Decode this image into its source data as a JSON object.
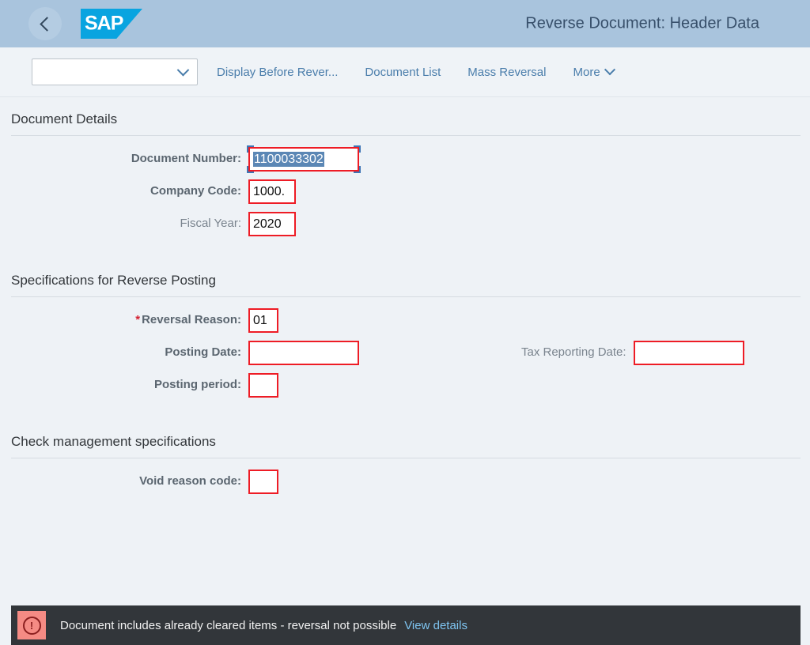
{
  "shell": {
    "back_icon": "chevron-left-icon",
    "logo_text": "SAP",
    "title": "Reverse Document: Header Data"
  },
  "toolbar": {
    "variant_value": "",
    "variant_icon": "chevron-down-icon",
    "buttons": [
      {
        "label": "Display Before Rever...",
        "icon": ""
      },
      {
        "label": "Document List",
        "icon": ""
      },
      {
        "label": "Mass Reversal",
        "icon": ""
      },
      {
        "label": "More",
        "icon": "chevron-down-icon"
      }
    ]
  },
  "sections": [
    {
      "title": "Document Details",
      "fields": [
        {
          "label": "Document Number:",
          "value": "1100033302",
          "required": false,
          "readonly": false,
          "selected": true,
          "width": "w-doc"
        },
        {
          "label": "Company Code:",
          "value": "1000.",
          "required": false,
          "readonly": false,
          "selected": false,
          "width": "w-small"
        },
        {
          "label": "Fiscal Year:",
          "value": "2020",
          "required": false,
          "readonly": true,
          "selected": false,
          "width": "w-small"
        }
      ]
    },
    {
      "title": "Specifications for Reverse Posting",
      "fields": [
        {
          "label": "Reversal Reason:",
          "value": "01",
          "required": true,
          "readonly": false,
          "selected": false,
          "width": "w-tiny"
        },
        {
          "label": "Posting Date:",
          "value": "",
          "required": false,
          "readonly": false,
          "selected": false,
          "width": "w-date"
        },
        {
          "label": "Posting period:",
          "value": "",
          "required": false,
          "readonly": false,
          "selected": false,
          "width": "w-tiny"
        }
      ],
      "right_fields": [
        {
          "label": "Tax Reporting Date:",
          "value": "",
          "required": false,
          "readonly": true,
          "selected": false,
          "width": "w-date"
        }
      ]
    },
    {
      "title": "Check management specifications",
      "fields": [
        {
          "label": "Void reason code:",
          "value": "",
          "required": false,
          "readonly": false,
          "selected": false,
          "width": "w-tiny"
        }
      ]
    }
  ],
  "message": {
    "icon": "error-icon",
    "text": "Document includes already cleared items - reversal not possible",
    "link": "View details"
  },
  "colors": {
    "header_bg": "#a9c4dd",
    "header_title": "#38506b",
    "page_bg": "#eef2f6",
    "field_border": "#ee1c25",
    "selection": "#5b87b5",
    "link": "#4a7dab",
    "message_bg": "#32363a",
    "message_icon_bg": "#f58b84",
    "message_link": "#7ec4f0",
    "logo_blue": "#09a4e0"
  }
}
